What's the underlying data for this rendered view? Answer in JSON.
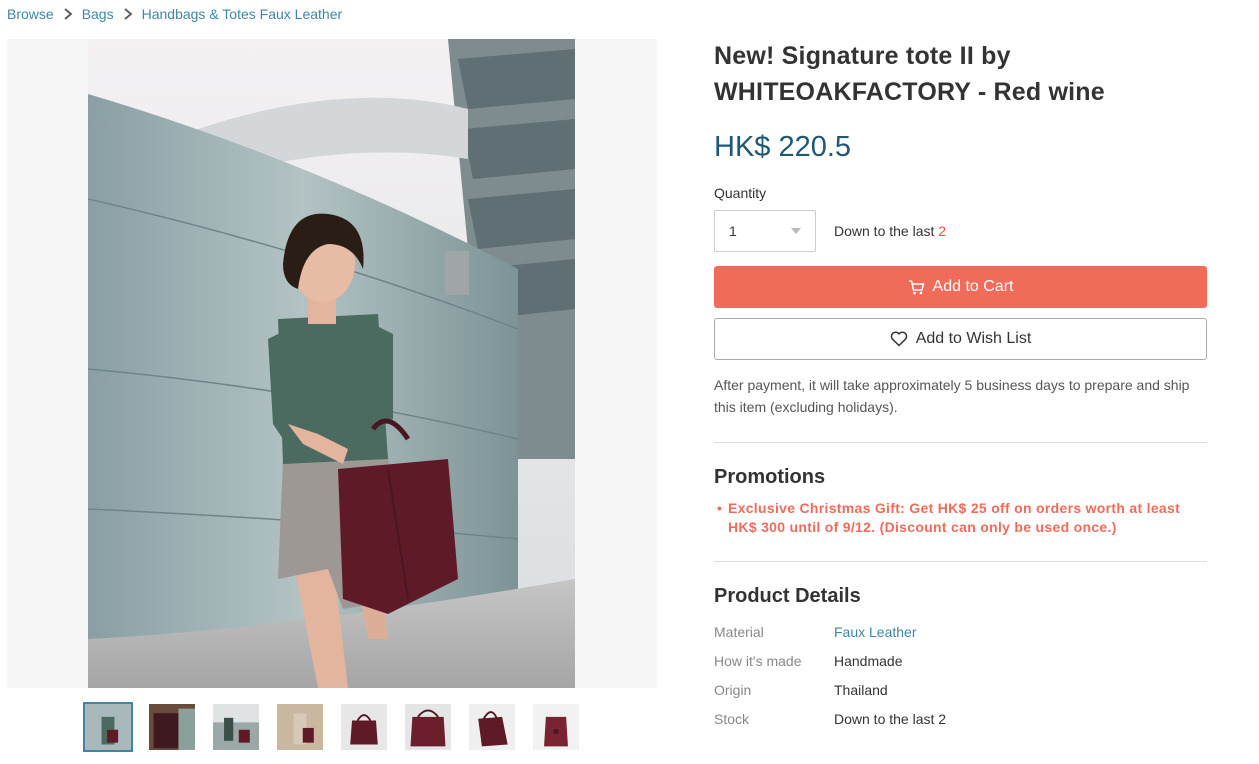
{
  "breadcrumb": [
    {
      "label": "Browse"
    },
    {
      "label": "Bags"
    },
    {
      "label": "Handbags & Totes Faux Leather"
    }
  ],
  "product": {
    "title": "New! Signature tote II by WHITEOAKFACTORY - Red wine",
    "price": "HK$ 220.5",
    "quantity_label": "Quantity",
    "quantity_value": "1",
    "stock_note_prefix": "Down to the last",
    "stock_count": "2",
    "add_to_cart_label": "Add to Cart",
    "add_to_wishlist_label": "Add to Wish List",
    "shipping_note": "After payment, it will take approximately 5 business days to prepare and ship this item (excluding holidays)."
  },
  "promotions": {
    "title": "Promotions",
    "items": [
      "Exclusive Christmas Gift: Get HK$ 25 off on orders worth at least HK$ 300 until of 9/12. (Discount can only be used once.)"
    ]
  },
  "details": {
    "title": "Product Details",
    "rows": [
      {
        "key": "Material",
        "value": "Faux Leather"
      },
      {
        "key": "How it's made",
        "value": "Handmade"
      },
      {
        "key": "Origin",
        "value": "Thailand"
      },
      {
        "key": "Stock",
        "value": "Down to the last 2"
      }
    ]
  },
  "thumbnails_count": 8,
  "colors": {
    "link": "#3f86a6",
    "price": "#1f5777",
    "cart_button": "#f16b5b",
    "promo_text": "#f16b5b",
    "stock_highlight": "#e74c3c"
  }
}
